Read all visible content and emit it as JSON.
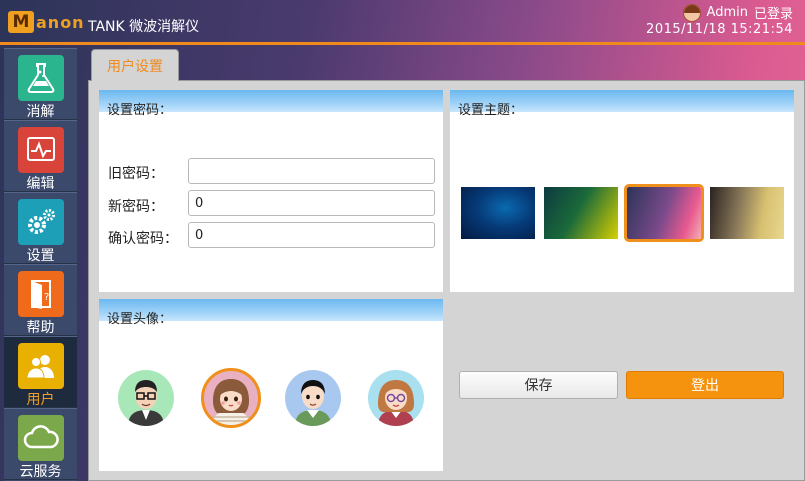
{
  "header": {
    "logo_letter": "M",
    "logo_text": "anon",
    "app_title": "TANK 微波消解仪",
    "username": "Admin",
    "login_status": "已登录",
    "datetime": "2015/11/18 15:21:54"
  },
  "sidebar": {
    "items": [
      {
        "label": "消解",
        "icon": "flask-icon",
        "color": "#2bb58f"
      },
      {
        "label": "编辑",
        "icon": "chart-edit-icon",
        "color": "#d9443a"
      },
      {
        "label": "设置",
        "icon": "gears-icon",
        "color": "#1e9fb8"
      },
      {
        "label": "帮助",
        "icon": "help-door-icon",
        "color": "#ef6a1a"
      },
      {
        "label": "用户",
        "icon": "users-icon",
        "color": "#e8b000"
      },
      {
        "label": "云服务",
        "icon": "cloud-icon",
        "color": "#7aa84a"
      }
    ],
    "active_index": 4
  },
  "tab": {
    "label": "用户设置"
  },
  "password_panel": {
    "title": "设置密码：",
    "old_label": "旧密码：",
    "old_value": "",
    "new_label": "新密码：",
    "new_value": "0",
    "confirm_label": "确认密码：",
    "confirm_value": "0"
  },
  "theme_panel": {
    "title": "设置主题：",
    "themes": [
      "deep-blue",
      "green-yellow",
      "purple-pink",
      "dark-gold"
    ],
    "selected_index": 2
  },
  "avatar_panel": {
    "title": "设置头像：",
    "avatars": [
      "glasses-man-avatar",
      "girl-avatar",
      "boy-avatar",
      "glasses-woman-avatar"
    ],
    "selected_index": 1
  },
  "actions": {
    "save_label": "保存",
    "logout_label": "登出"
  },
  "colors": {
    "accent": "#f0901c",
    "panel_header": "#8ecbf5"
  }
}
